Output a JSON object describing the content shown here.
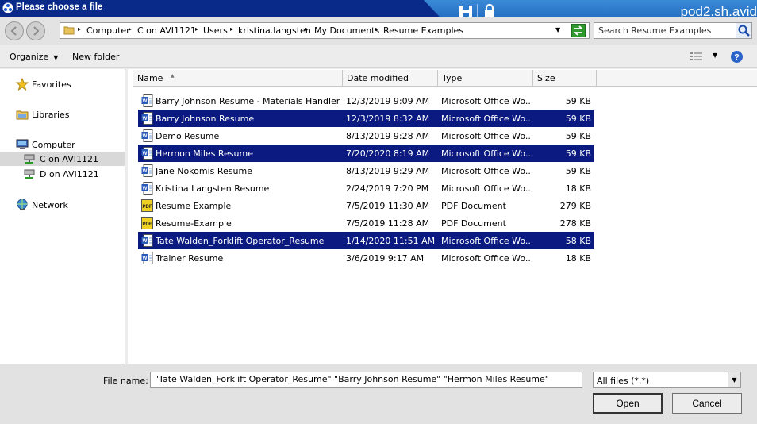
{
  "window": {
    "title": "Please choose a file",
    "remote_host": "pod2.sh.avid"
  },
  "nav": {
    "back_icon": "back-arrow-icon",
    "forward_icon": "forward-arrow-icon"
  },
  "breadcrumb": [
    "Computer",
    "C on AVI1121",
    "Users",
    "kristina.langsten",
    "My Documents",
    "Resume Examples"
  ],
  "search": {
    "placeholder": "Search Resume Examples"
  },
  "toolbar": {
    "organize_label": "Organize",
    "new_folder_label": "New folder",
    "view_icon": "view-list-icon",
    "help_icon": "help-icon"
  },
  "sidebar": {
    "items": [
      {
        "label": "Favorites",
        "icon": "star-icon"
      },
      {
        "label": "Libraries",
        "icon": "library-icon"
      },
      {
        "label": "Computer",
        "icon": "computer-icon"
      },
      {
        "label": "C on AVI1121",
        "icon": "network-drive-icon",
        "selected": true
      },
      {
        "label": "D on AVI1121",
        "icon": "network-drive-icon"
      },
      {
        "label": "Network",
        "icon": "network-icon"
      }
    ]
  },
  "columns": {
    "name": "Name",
    "date": "Date modified",
    "type": "Type",
    "size": "Size"
  },
  "files": [
    {
      "name": "Barry Johnson Resume - Materials Handler",
      "date": "12/3/2019 9:09 AM",
      "type": "Microsoft Office Wo...",
      "size": "59 KB",
      "kind": "word",
      "selected": false
    },
    {
      "name": "Barry Johnson Resume",
      "date": "12/3/2019 8:32 AM",
      "type": "Microsoft Office Wo...",
      "size": "59 KB",
      "kind": "word",
      "selected": true
    },
    {
      "name": "Demo Resume",
      "date": "8/13/2019 9:28 AM",
      "type": "Microsoft Office Wo...",
      "size": "59 KB",
      "kind": "word",
      "selected": false
    },
    {
      "name": "Hermon Miles Resume",
      "date": "7/20/2020 8:19 AM",
      "type": "Microsoft Office Wo...",
      "size": "59 KB",
      "kind": "word",
      "selected": true
    },
    {
      "name": "Jane Nokomis Resume",
      "date": "8/13/2019 9:29 AM",
      "type": "Microsoft Office Wo...",
      "size": "59 KB",
      "kind": "word",
      "selected": false
    },
    {
      "name": "Kristina Langsten Resume",
      "date": "2/24/2019 7:20 PM",
      "type": "Microsoft Office Wo...",
      "size": "18 KB",
      "kind": "word",
      "selected": false
    },
    {
      "name": "Resume Example",
      "date": "7/5/2019 11:30 AM",
      "type": "PDF Document",
      "size": "279 KB",
      "kind": "pdf",
      "selected": false
    },
    {
      "name": "Resume-Example",
      "date": "7/5/2019 11:28 AM",
      "type": "PDF Document",
      "size": "278 KB",
      "kind": "pdf",
      "selected": false
    },
    {
      "name": "Tate Walden_Forklift Operator_Resume",
      "date": "1/14/2020 11:51 AM",
      "type": "Microsoft Office Wo...",
      "size": "58 KB",
      "kind": "word",
      "selected": true
    },
    {
      "name": "Trainer Resume",
      "date": "3/6/2019 9:17 AM",
      "type": "Microsoft Office Wo...",
      "size": "18 KB",
      "kind": "word",
      "selected": false
    }
  ],
  "footer": {
    "file_name_label": "File name:",
    "file_name_value": "\"Tate Walden_Forklift Operator_Resume\" \"Barry Johnson Resume\" \"Hermon Miles Resume\"",
    "filter_value": "All files (*.*)",
    "open_label": "Open",
    "cancel_label": "Cancel"
  },
  "colors": {
    "titlebar": "#0a2a8a",
    "selection": "#0a1a80",
    "remote_bar": "#2a78c8"
  }
}
